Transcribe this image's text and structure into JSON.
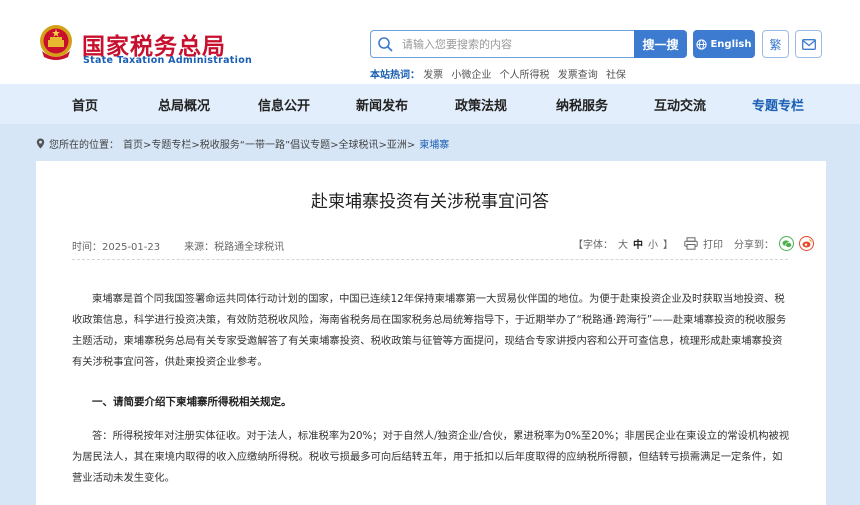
{
  "header": {
    "logo_cn": "国家税务总局",
    "logo_en": "State Taxation Administration",
    "search_placeholder": "请输入您要搜索的内容",
    "search_button": "搜一搜",
    "english_button": "English",
    "traditional_button": "繁",
    "icons": {
      "search": "search-icon",
      "globe": "globe-icon",
      "mail": "mail-icon",
      "emblem": "national-emblem"
    },
    "hot_label": "本站热词：",
    "hot_words": [
      "发票",
      "小微企业",
      "个人所得税",
      "发票查询",
      "社保"
    ]
  },
  "nav": {
    "items": [
      "首页",
      "总局概况",
      "信息公开",
      "新闻发布",
      "政策法规",
      "纳税服务",
      "互动交流",
      "专题专栏"
    ],
    "active_index": 7
  },
  "breadcrumb": {
    "label": "您所在的位置：",
    "path": "首页>专题专栏>税收服务“一带一路”倡议专题>全球税讯>亚洲>",
    "current": "柬埔寨"
  },
  "article": {
    "title": "赴柬埔寨投资有关涉税事宜问答",
    "time_label": "时间：2025-01-23",
    "source_label": "来源：税路通全球税讯",
    "font_label": "【字体：",
    "font_large": "大",
    "font_medium": "中",
    "font_small": "小",
    "font_close": "】",
    "print_label": "打印",
    "share_label": "分享到：",
    "share_colors": {
      "wechat": "#4caf50",
      "weibo": "#e6492d"
    },
    "paragraph1": "柬埔寨是首个同我国签署命运共同体行动计划的国家，中国已连续12年保持柬埔寨第一大贸易伙伴国的地位。为便于赴柬投资企业及时获取当地投资、税收政策信息，科学进行投资决策，有效防范税收风险，海南省税务局在国家税务总局统筹指导下，于近期举办了“税路通·跨海行”——赴柬埔寨投资的税收服务主题活动，柬埔寨税务总局有关专家受邀解答了有关柬埔寨投资、税收政策与征管等方面提问，现结合专家讲授内容和公开可查信息，梳理形成赴柬埔寨投资有关涉税事宜问答，供赴柬投资企业参考。",
    "question1": "一、请简要介绍下柬埔寨所得税相关规定。",
    "answer1": "答：所得税按年对注册实体征收。对于法人，标准税率为20%；对于自然人/独资企业/合伙，累进税率为0%至20%；非居民企业在柬设立的常设机构被视为居民法人，其在柬境内取得的收入应缴纳所得税。税收亏损最多可向后结转五年，用于抵扣以后年度取得的应纳税所得额，但结转亏损需满足一定条件，如营业活动未发生变化。"
  },
  "colors": {
    "brand_red": "#c8102e",
    "brand_blue": "#1a5fb4",
    "button_blue": "#3d7bd1",
    "nav_bg": "#e2eefb",
    "band_bg": "#d6e6f7"
  }
}
